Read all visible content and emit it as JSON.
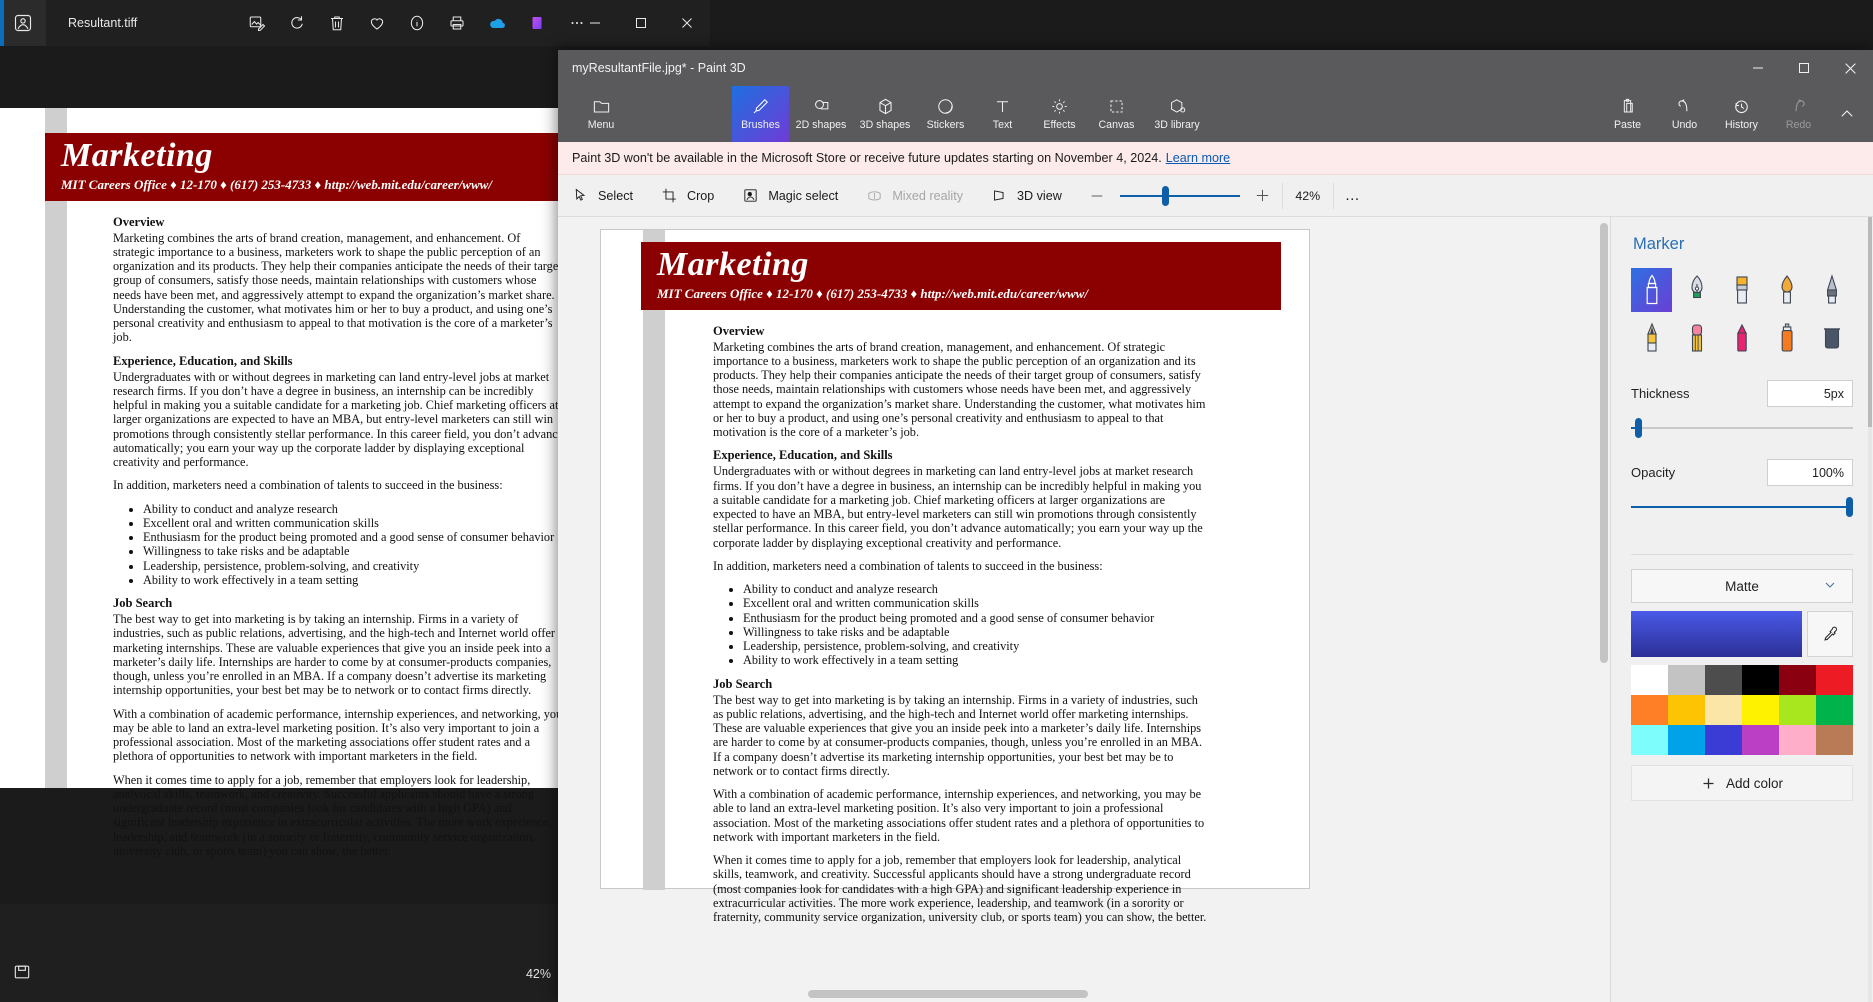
{
  "photos": {
    "app_icon": "photos-icon",
    "filename": "Resultant.tiff",
    "tools": [
      {
        "name": "edit-image-icon",
        "label": "Edit image"
      },
      {
        "name": "rotate-icon",
        "label": "Rotate"
      },
      {
        "name": "delete-icon",
        "label": "Delete"
      },
      {
        "name": "favorite-heart-icon",
        "label": "Add to favorites"
      },
      {
        "name": "info-icon",
        "label": "File info"
      },
      {
        "name": "print-icon",
        "label": "Print"
      },
      {
        "name": "onedrive-icon",
        "label": "OneDrive"
      },
      {
        "name": "designer-icon",
        "label": "Designer"
      },
      {
        "name": "more-options-icon",
        "label": "See more"
      }
    ],
    "window_controls": [
      "minimize",
      "maximize",
      "close"
    ],
    "status": {
      "zoom": "42%",
      "save_icon": "save-icon",
      "zoom_out_icon": "zoom-out-icon"
    }
  },
  "paint3d": {
    "title": "myResultantFile.jpg* - Paint 3D",
    "window_controls": [
      "minimize",
      "maximize",
      "close"
    ],
    "ribbon": {
      "menu": "Menu",
      "items": [
        {
          "label": "Brushes",
          "icon": "brush-icon",
          "active": true,
          "disabled": false
        },
        {
          "label": "2D shapes",
          "icon": "2d-shapes-icon",
          "active": false,
          "disabled": false
        },
        {
          "label": "3D shapes",
          "icon": "3d-shapes-icon",
          "active": false,
          "disabled": false
        },
        {
          "label": "Stickers",
          "icon": "stickers-icon",
          "active": false,
          "disabled": false
        },
        {
          "label": "Text",
          "icon": "text-icon",
          "active": false,
          "disabled": false
        },
        {
          "label": "Effects",
          "icon": "effects-icon",
          "active": false,
          "disabled": false
        },
        {
          "label": "Canvas",
          "icon": "canvas-icon",
          "active": false,
          "disabled": false
        },
        {
          "label": "3D library",
          "icon": "3d-library-icon",
          "active": false,
          "disabled": false
        }
      ],
      "right_items": [
        {
          "label": "Paste",
          "icon": "paste-icon",
          "disabled": false
        },
        {
          "label": "Undo",
          "icon": "undo-icon",
          "disabled": false
        },
        {
          "label": "History",
          "icon": "history-icon",
          "disabled": false
        },
        {
          "label": "Redo",
          "icon": "redo-icon",
          "disabled": true
        }
      ],
      "collapse_icon": "chevron-up-icon"
    },
    "banner": {
      "text": "Paint 3D won't be available in the Microsoft Store or receive future updates starting on November 4, 2024.",
      "link": "Learn more"
    },
    "toolbar": {
      "items": [
        {
          "label": "Select",
          "icon": "cursor-select-icon",
          "disabled": false
        },
        {
          "label": "Crop",
          "icon": "crop-icon",
          "disabled": false
        },
        {
          "label": "Magic select",
          "icon": "magic-select-icon",
          "disabled": false
        },
        {
          "label": "Mixed reality",
          "icon": "mixed-reality-icon",
          "disabled": true
        },
        {
          "label": "3D view",
          "icon": "3d-view-icon",
          "disabled": false
        }
      ],
      "zoom_out_icon": "minus-icon",
      "zoom_in_icon": "plus-icon",
      "zoom_value": "42%",
      "more_icon": "more-options-icon"
    },
    "panel": {
      "title": "Marker",
      "brushes": [
        {
          "name": "marker-brush",
          "selected": true
        },
        {
          "name": "calligraphy-pen-brush",
          "selected": false
        },
        {
          "name": "oil-brush",
          "selected": false
        },
        {
          "name": "watercolor-brush",
          "selected": false
        },
        {
          "name": "pixel-pen-brush",
          "selected": false
        },
        {
          "name": "pencil-brush",
          "selected": false
        },
        {
          "name": "eraser-brush",
          "selected": false
        },
        {
          "name": "crayon-brush",
          "selected": false
        },
        {
          "name": "spray-can-brush",
          "selected": false
        },
        {
          "name": "fill-bucket-brush",
          "selected": false
        }
      ],
      "thickness": {
        "label": "Thickness",
        "value": "5px",
        "percent": 4
      },
      "opacity": {
        "label": "Opacity",
        "value": "100%",
        "percent": 100
      },
      "material": {
        "value": "Matte",
        "chevron": "chevron-down-icon"
      },
      "current_color": "#3c49c8",
      "eyedropper_icon": "eyedropper-icon",
      "swatches": [
        "#ffffff",
        "#c3c3c3",
        "#4d4d4d",
        "#000000",
        "#8a0011",
        "#ed1c24",
        "#ff7f27",
        "#fdc403",
        "#fbe6a7",
        "#fff200",
        "#a8e61d",
        "#00b44b",
        "#7efdfd",
        "#00a2e8",
        "#3b3bd6",
        "#bb3fc4",
        "#ffaec9",
        "#b97a56"
      ],
      "add_color": {
        "label": "Add color",
        "icon": "plus-icon"
      }
    }
  },
  "document": {
    "banner_title": "Marketing",
    "banner_subtitle": "MIT Careers Office ♦ 12-170 ♦ (617) 253-4733 ♦ http://web.mit.edu/career/www/",
    "sections": [
      {
        "heading": "Overview",
        "paragraphs": [
          "Marketing combines the arts of brand creation, management, and enhancement.  Of strategic importance to a business, marketers work to shape the public perception of an organization and its products.  They help their companies anticipate the needs of their target group of consumers, satisfy those needs, maintain relationships with customers whose needs have been met, and aggressively attempt to expand the organization’s market share.  Understanding the customer, what motivates him or her to buy a product, and using one’s personal creativity and enthusiasm to appeal to that motivation is the core of a marketer’s job."
        ],
        "bullets": []
      },
      {
        "heading": "Experience, Education, and Skills",
        "paragraphs": [
          "Undergraduates with or without degrees in marketing can land entry-level jobs at market research firms.  If you don’t have a degree in business, an internship can be incredibly helpful in making you a suitable candidate for a marketing job.  Chief marketing officers at larger organizations are expected to have an MBA, but entry-level marketers can still win promotions through consistently stellar performance.  In this career field, you don’t advance automatically; you earn your way up the corporate ladder by displaying exceptional creativity and performance.",
          "In addition, marketers need a combination of talents to succeed in the business:"
        ],
        "bullets": [
          "Ability to conduct and analyze research",
          "Excellent oral and written communication skills",
          "Enthusiasm for the product being promoted and a good sense of consumer behavior",
          "Willingness to take risks and be adaptable",
          "Leadership, persistence, problem-solving, and creativity",
          "Ability to work effectively in a team setting"
        ]
      },
      {
        "heading": "Job Search",
        "paragraphs": [
          "The best way to get into marketing is by taking an internship.  Firms in a variety of industries, such as public relations, advertising, and the high-tech and Internet world offer marketing internships.  These are valuable experiences that give you an inside peek into a marketer’s daily life.  Internships are harder to come by at consumer-products companies, though, unless you’re enrolled in an MBA.  If a company doesn’t advertise its marketing internship opportunities, your best bet may be to network or to contact firms directly.",
          "With a combination of academic performance, internship experiences, and networking, you may be able to land an extra-level marketing position.  It’s also very important to join a professional association.  Most of the marketing associations offer student rates and a plethora of opportunities to network with important marketers in the field.",
          "When it comes time to apply for a job, remember that employers look for leadership, analytical skills, teamwork, and creativity.  Successful applicants should have a strong undergraduate record (most companies look for candidates with a high GPA) and significant leadership experience in extracurricular activities.  The more work experience, leadership, and teamwork (in a sorority or fraternity, community service organization, university club, or sports team) you can show, the better."
        ],
        "bullets": []
      }
    ]
  }
}
